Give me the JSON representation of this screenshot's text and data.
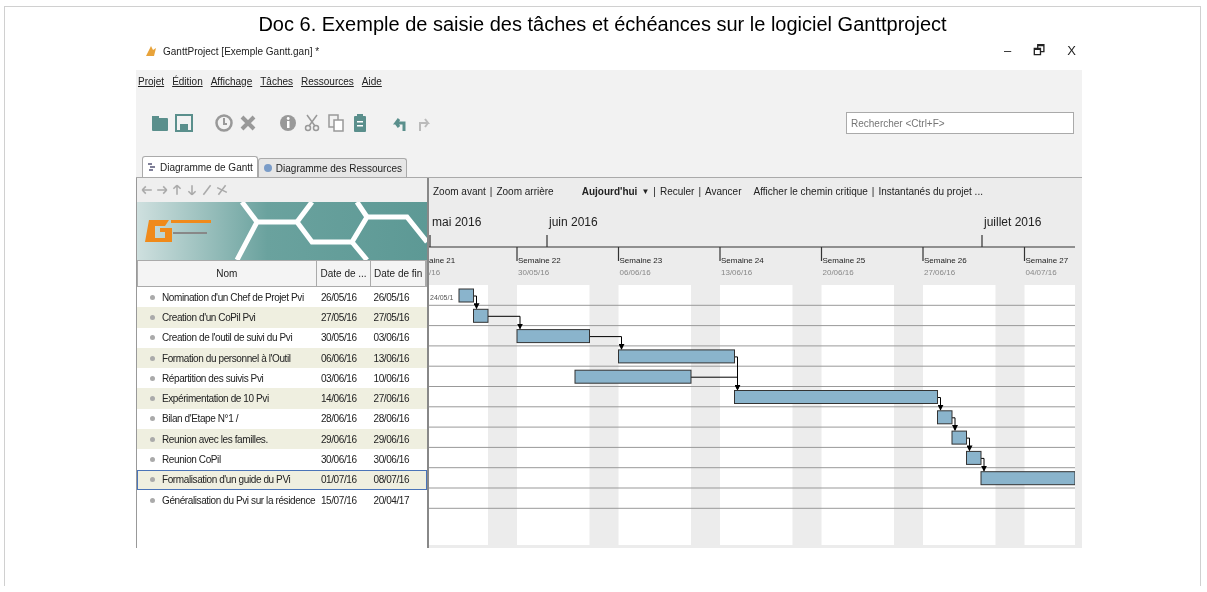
{
  "document_title": "Doc 6. Exemple de saisie des tâches et échéances sur le logiciel Ganttproject",
  "window": {
    "title": "GanttProject [Exemple Gantt.gan] *",
    "controls": [
      "–",
      "🗗",
      "X"
    ]
  },
  "menu": [
    "Projet",
    "Édition",
    "Affichage",
    "Tâches",
    "Ressources",
    "Aide"
  ],
  "search": {
    "placeholder": "Rechercher <Ctrl+F>"
  },
  "tabs": [
    {
      "label": "Diagramme de Gantt",
      "selected": true
    },
    {
      "label": "Diagramme des Ressources",
      "selected": false
    }
  ],
  "task_table": {
    "columns": [
      "Nom",
      "Date de ...",
      "Date de fin"
    ],
    "rows": [
      {
        "name": "Nomination d'un Chef de Projet Pvi",
        "start": "26/05/16",
        "end": "26/05/16",
        "selected": false
      },
      {
        "name": "Creation d'un CoPil Pvi",
        "start": "27/05/16",
        "end": "27/05/16",
        "selected": false
      },
      {
        "name": "Creation de l'outil de suivi du Pvi",
        "start": "30/05/16",
        "end": "03/06/16",
        "selected": false
      },
      {
        "name": "Formation du personnel à l'Outil",
        "start": "06/06/16",
        "end": "13/06/16",
        "selected": false
      },
      {
        "name": "Répartition des suivis Pvi",
        "start": "03/06/16",
        "end": "10/06/16",
        "selected": false
      },
      {
        "name": "Expérimentation de 10 Pvi",
        "start": "14/06/16",
        "end": "27/06/16",
        "selected": false
      },
      {
        "name": "Bilan d'Etape N°1 /",
        "start": "28/06/16",
        "end": "28/06/16",
        "selected": false
      },
      {
        "name": "Reunion avec les familles.",
        "start": "29/06/16",
        "end": "29/06/16",
        "selected": false
      },
      {
        "name": "Reunion CoPil",
        "start": "30/06/16",
        "end": "30/06/16",
        "selected": false
      },
      {
        "name": "Formalisation d'un guide du PVi",
        "start": "01/07/16",
        "end": "08/07/16",
        "selected": true
      },
      {
        "name": "Généralisation du Pvi sur la résidence",
        "start": "15/07/16",
        "end": "20/04/17",
        "selected": false
      }
    ]
  },
  "chart_toolbar": [
    {
      "label": "Zoom avant",
      "kind": "link"
    },
    {
      "label": "|",
      "kind": "sep"
    },
    {
      "label": "Zoom arrière",
      "kind": "link"
    },
    {
      "label": "Aujourd'hui",
      "kind": "menu"
    },
    {
      "label": "▼",
      "kind": "caret"
    },
    {
      "label": "|",
      "kind": "sep"
    },
    {
      "label": "Reculer",
      "kind": "link"
    },
    {
      "label": "|",
      "kind": "sep"
    },
    {
      "label": "Avancer",
      "kind": "link"
    },
    {
      "label": "Afficher le chemin critique",
      "kind": "link"
    },
    {
      "label": "|",
      "kind": "sep"
    },
    {
      "label": "Instantanés du projet ...",
      "kind": "link"
    }
  ],
  "timeline": {
    "months": [
      "mai 2016",
      "juin 2016",
      "juillet 2016"
    ],
    "weeks": [
      {
        "label": "aine 21",
        "date": "/16"
      },
      {
        "label": "Semaine 22",
        "date": "30/05/16"
      },
      {
        "label": "Semaine 23",
        "date": "06/06/16"
      },
      {
        "label": "Semaine 24",
        "date": "13/06/16"
      },
      {
        "label": "Semaine 25",
        "date": "20/06/16"
      },
      {
        "label": "Semaine 26",
        "date": "27/06/16"
      },
      {
        "label": "Semaine 27",
        "date": "04/07/16"
      }
    ],
    "today_label": "24/05/1"
  }
}
